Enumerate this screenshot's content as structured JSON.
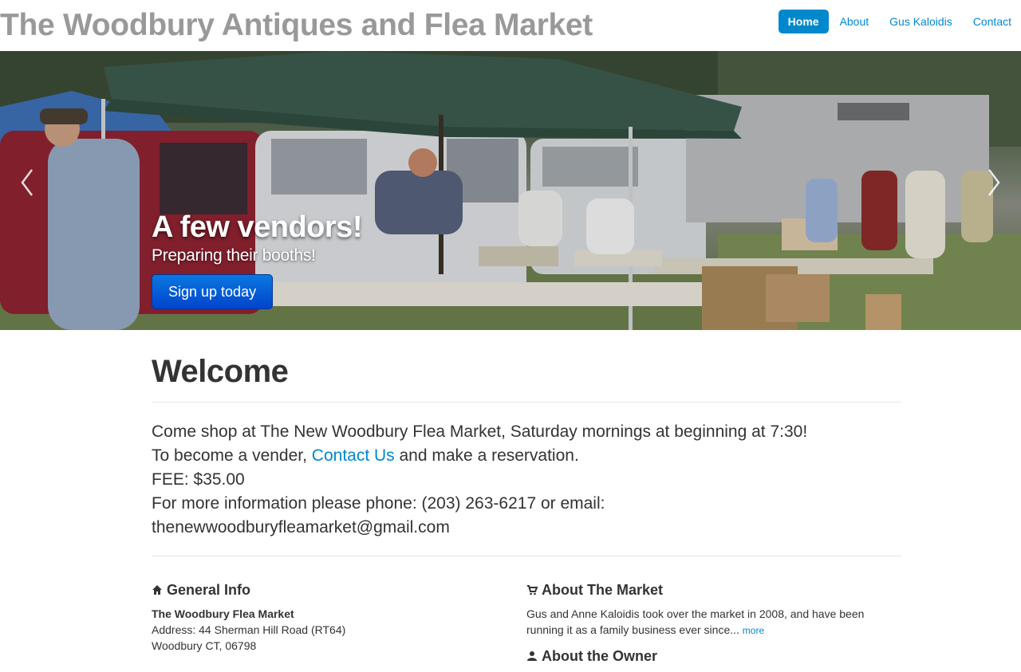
{
  "header": {
    "site_title": "The Woodbury Antiques and Flea Market",
    "nav": [
      {
        "label": "Home",
        "active": true
      },
      {
        "label": "About",
        "active": false
      },
      {
        "label": "Gus Kaloidis",
        "active": false
      },
      {
        "label": "Contact",
        "active": false
      }
    ]
  },
  "hero": {
    "title": "A few vendors!",
    "subtitle": "Preparing their booths!",
    "button_label": "Sign up today",
    "prev_icon": "chevron-left-icon",
    "next_icon": "chevron-right-icon"
  },
  "welcome": {
    "heading": "Welcome",
    "line1": "Come shop at The New Woodbury Flea Market, Saturday mornings at beginning at 7:30!",
    "line2_prefix": "To become a vender, ",
    "line2_link": "Contact Us",
    "line2_suffix": " and make a reservation.",
    "fee": "FEE: $35.00",
    "contact_line": "For more information please phone: (203) 263-6217 or email: thenewwoodburyfleamarket@gmail.com"
  },
  "general_info": {
    "icon": "home-icon",
    "heading": "General Info",
    "name": "The Woodbury Flea Market",
    "address": "Address: 44 Sherman Hill Road (RT64)",
    "city": "Woodbury CT, 06798"
  },
  "about_market": {
    "icon": "shopping-cart-icon",
    "heading": "About The Market",
    "text": "Gus and Anne Kaloidis took over the market in 2008, and have been running it as a family business ever since...",
    "more_label": "more"
  },
  "about_owner": {
    "icon": "user-icon",
    "heading": "About the Owner"
  },
  "colors": {
    "link": "#0088cc",
    "title_gray": "#999999",
    "button_blue": "#0044cc"
  }
}
